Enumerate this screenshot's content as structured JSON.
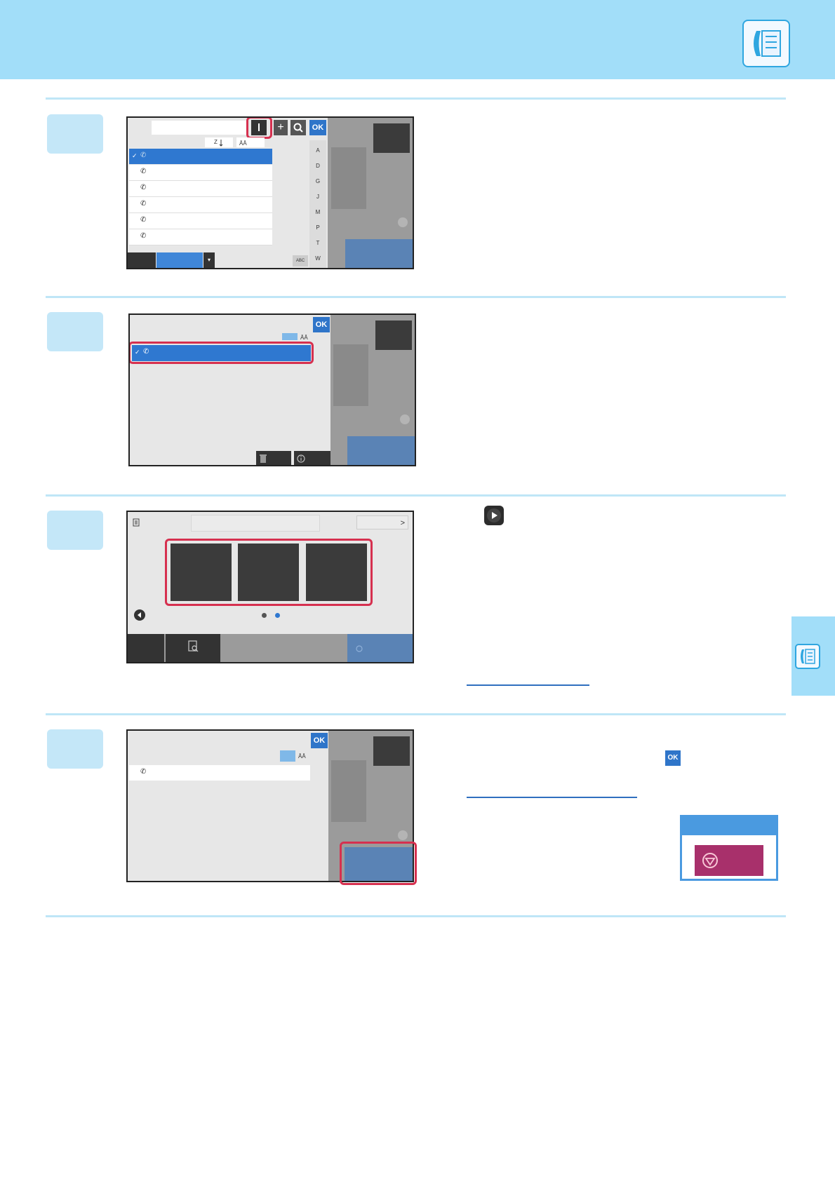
{
  "step1": {
    "ok_label": "OK",
    "index_letters": [
      "A",
      "D",
      "G",
      "J",
      "M",
      "P",
      "T",
      "W"
    ],
    "abc_label": "ABC"
  },
  "step2": {
    "ok_label": "OK"
  },
  "step4": {
    "ok_label": "OK",
    "inline_ok_label": "OK"
  },
  "step3": {
    "next_label": ">"
  }
}
